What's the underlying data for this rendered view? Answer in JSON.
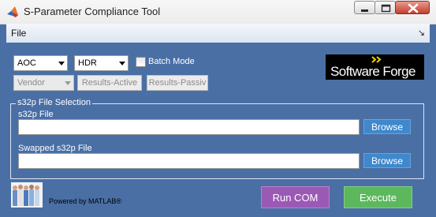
{
  "window": {
    "title": "S-Parameter Compliance Tool",
    "icon": "matlab-icon",
    "controls": [
      "minimize-icon",
      "maximize-icon",
      "close-icon"
    ]
  },
  "menubar": {
    "file_label": "File",
    "overflow_icon": "menu-arrow-icon"
  },
  "controls": {
    "type_select": {
      "value": "AOC"
    },
    "rate_select": {
      "value": "HDR"
    },
    "batch_mode": {
      "label": "Batch Mode",
      "checked": false
    },
    "vendor_select": {
      "value": "Vendor",
      "enabled": false
    },
    "results_active_label": "Results-Active",
    "results_passive_label": "Results-Passiv"
  },
  "logo": {
    "text": "Software Forge"
  },
  "file_selection": {
    "group_title": "s32p File Selection",
    "s32p_label": "s32p File",
    "s32p_value": "",
    "swapped_label": "Swapped s32p File",
    "swapped_value": "",
    "browse_label": "Browse"
  },
  "footer": {
    "powered_by": "Powered by MATLAB®",
    "run_com_label": "Run COM",
    "execute_label": "Execute"
  },
  "colors": {
    "background": "#4a6fa5",
    "browse_button": "#3f88cc",
    "run_com_button": "#9b59b6",
    "execute_button": "#5cb85c"
  }
}
